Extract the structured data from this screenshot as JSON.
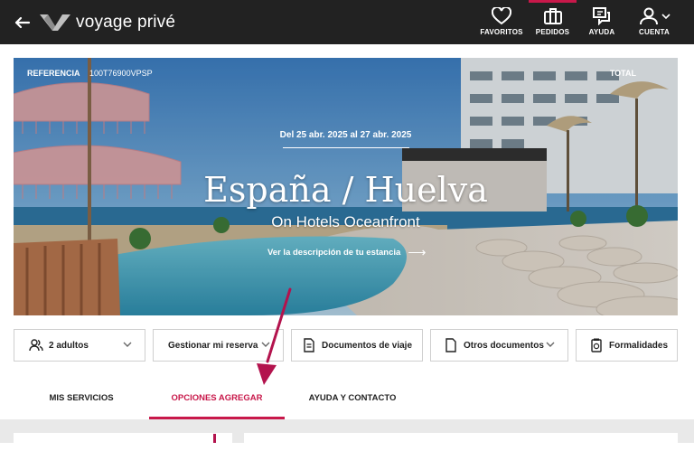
{
  "header": {
    "logo_text": "voyage privé",
    "nav": [
      {
        "label": "FAVORITOS",
        "icon": "heart-icon"
      },
      {
        "label": "PEDIDOS",
        "icon": "suitcase-icon"
      },
      {
        "label": "AYUDA",
        "icon": "chat-help-icon"
      },
      {
        "label": "CUENTA",
        "icon": "user-icon"
      }
    ],
    "active_nav": "PEDIDOS"
  },
  "hero": {
    "reference_label": "REFERENCIA",
    "reference_value": "100T76900VPSP",
    "total_label": "TOTAL",
    "dates": "Del 25 abr. 2025 al 27 abr. 2025",
    "title": "España / Huelva",
    "hotel": "On Hotels Oceanfront",
    "description_link": "Ver la descripción de tu estancia"
  },
  "actions": {
    "adults": "2 adultos",
    "manage": "Gestionar mi reserva",
    "travel_docs": "Documentos de viaje",
    "other_docs": "Otros documentos",
    "formalities": "Formalidades"
  },
  "tabs": [
    {
      "label": "MIS SERVICIOS"
    },
    {
      "label": "OPCIONES AGREGAR"
    },
    {
      "label": "AYUDA Y CONTACTO"
    }
  ],
  "active_tab": "OPCIONES AGREGAR",
  "colors": {
    "accent": "#c8184a",
    "header_bg": "#222222"
  }
}
